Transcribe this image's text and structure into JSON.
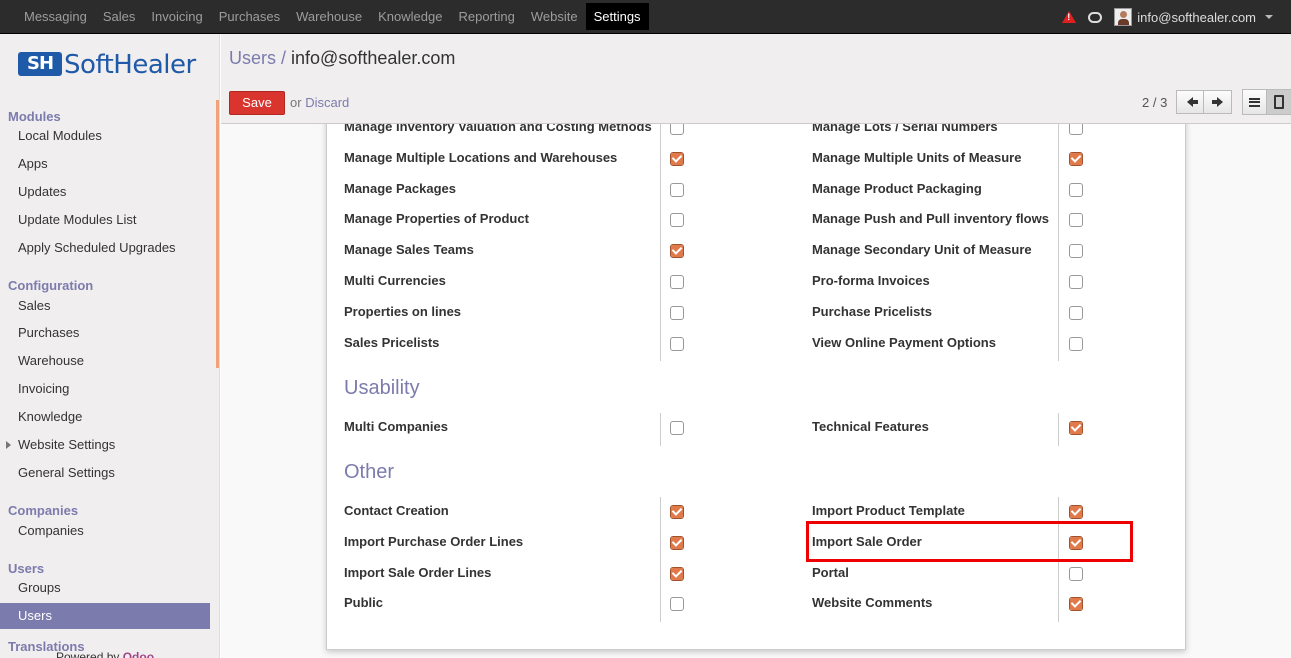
{
  "topbar": {
    "menu": [
      "Messaging",
      "Sales",
      "Invoicing",
      "Purchases",
      "Warehouse",
      "Knowledge",
      "Reporting",
      "Website",
      "Settings"
    ],
    "active": "Settings",
    "user": "info@softhealer.com"
  },
  "sidebar": {
    "logo": {
      "mark": "SH",
      "text": "SoftHealer"
    },
    "sections": [
      {
        "title": "Modules",
        "items": [
          "Local Modules",
          "Apps",
          "Updates",
          "Update Modules List",
          "Apply Scheduled Upgrades"
        ]
      },
      {
        "title": "Configuration",
        "items": [
          "Sales",
          "Purchases",
          "Warehouse",
          "Invoicing",
          "Knowledge",
          "Website Settings",
          "General Settings"
        ]
      },
      {
        "title": "Companies",
        "items": [
          "Companies"
        ]
      },
      {
        "title": "Users",
        "items": [
          "Groups",
          "Users"
        ]
      },
      {
        "title": "Translations",
        "items": []
      }
    ],
    "active_item": "Users",
    "powered_prefix": "Powered by",
    "powered_brand": "Odoo"
  },
  "control_panel": {
    "breadcrumb_parent": "Users",
    "breadcrumb_sep": " / ",
    "breadcrumb_current": "info@softhealer.com",
    "save_label": "Save",
    "or_text": "or",
    "discard_label": "Discard",
    "pager": "2 / 3"
  },
  "form": {
    "rows_top": [
      {
        "left": "Manage Inventory Valuation and Costing Methods",
        "left_checked": false,
        "right": "Manage Lots / Serial Numbers",
        "right_checked": false
      },
      {
        "left": "Manage Multiple Locations and Warehouses",
        "left_checked": true,
        "right": "Manage Multiple Units of Measure",
        "right_checked": true
      },
      {
        "left": "Manage Packages",
        "left_checked": false,
        "right": "Manage Product Packaging",
        "right_checked": false
      },
      {
        "left": "Manage Properties of Product",
        "left_checked": false,
        "right": "Manage Push and Pull inventory flows",
        "right_checked": false
      },
      {
        "left": "Manage Sales Teams",
        "left_checked": true,
        "right": "Manage Secondary Unit of Measure",
        "right_checked": false
      },
      {
        "left": "Multi Currencies",
        "left_checked": false,
        "right": "Pro-forma Invoices",
        "right_checked": false
      },
      {
        "left": "Properties on lines",
        "left_checked": false,
        "right": "Purchase Pricelists",
        "right_checked": false
      },
      {
        "left": "Sales Pricelists",
        "left_checked": false,
        "right": "View Online Payment Options",
        "right_checked": false
      }
    ],
    "usability_title": "Usability",
    "rows_usability": [
      {
        "left": "Multi Companies",
        "left_checked": false,
        "right": "Technical Features",
        "right_checked": true
      }
    ],
    "other_title": "Other",
    "rows_other": [
      {
        "left": "Contact Creation",
        "left_checked": true,
        "right": "Import Product Template",
        "right_checked": true
      },
      {
        "left": "Import Purchase Order Lines",
        "left_checked": true,
        "right": "Import Sale Order",
        "right_checked": true
      },
      {
        "left": "Import Sale Order Lines",
        "left_checked": true,
        "right": "Portal",
        "right_checked": false
      },
      {
        "left": "Public",
        "left_checked": false,
        "right": "Website Comments",
        "right_checked": true
      }
    ]
  }
}
